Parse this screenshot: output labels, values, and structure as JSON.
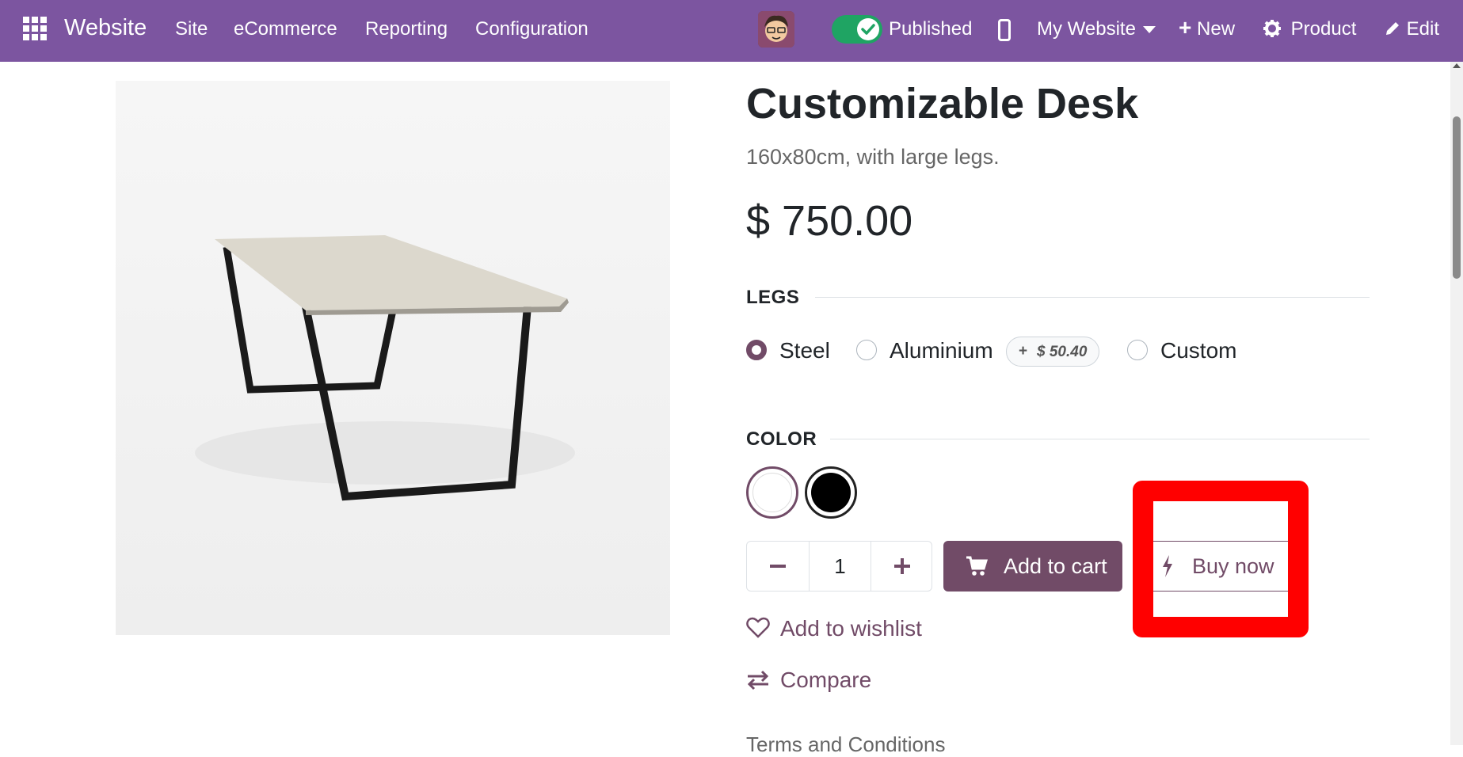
{
  "topbar": {
    "brand": "Website",
    "menu": [
      "Site",
      "eCommerce",
      "Reporting",
      "Configuration"
    ],
    "published_label": "Published",
    "website_label": "My Website",
    "new_label": "New",
    "product_label": "Product",
    "edit_label": "Edit"
  },
  "product": {
    "title": "Customizable Desk",
    "subtitle": "160x80cm, with large legs.",
    "price": "$ 750.00",
    "legs": {
      "label": "LEGS",
      "options": [
        {
          "label": "Steel",
          "selected": true
        },
        {
          "label": "Aluminium",
          "selected": false,
          "extra_sign": "+",
          "extra": "$ 50.40"
        },
        {
          "label": "Custom",
          "selected": false
        }
      ]
    },
    "color": {
      "label": "COLOR",
      "options": [
        {
          "name": "white",
          "hex": "#ffffff",
          "selected": true
        },
        {
          "name": "black",
          "hex": "#000000",
          "selected": false
        }
      ]
    },
    "quantity": "1",
    "add_to_cart_label": "Add to cart",
    "buy_now_label": "Buy now",
    "wishlist_label": "Add to wishlist",
    "compare_label": "Compare",
    "terms_label": "Terms and Conditions"
  },
  "colors": {
    "topbar": "#7c55a0",
    "primary": "#714b67",
    "published_toggle": "#1fa463",
    "highlight": "#ff0000"
  },
  "icons": [
    "apps-grid-icon",
    "check-icon",
    "mobile-icon",
    "caret-down-icon",
    "plus-icon",
    "gear-icon",
    "pencil-icon",
    "cart-icon",
    "bolt-icon",
    "heart-icon",
    "compare-arrows-icon"
  ]
}
